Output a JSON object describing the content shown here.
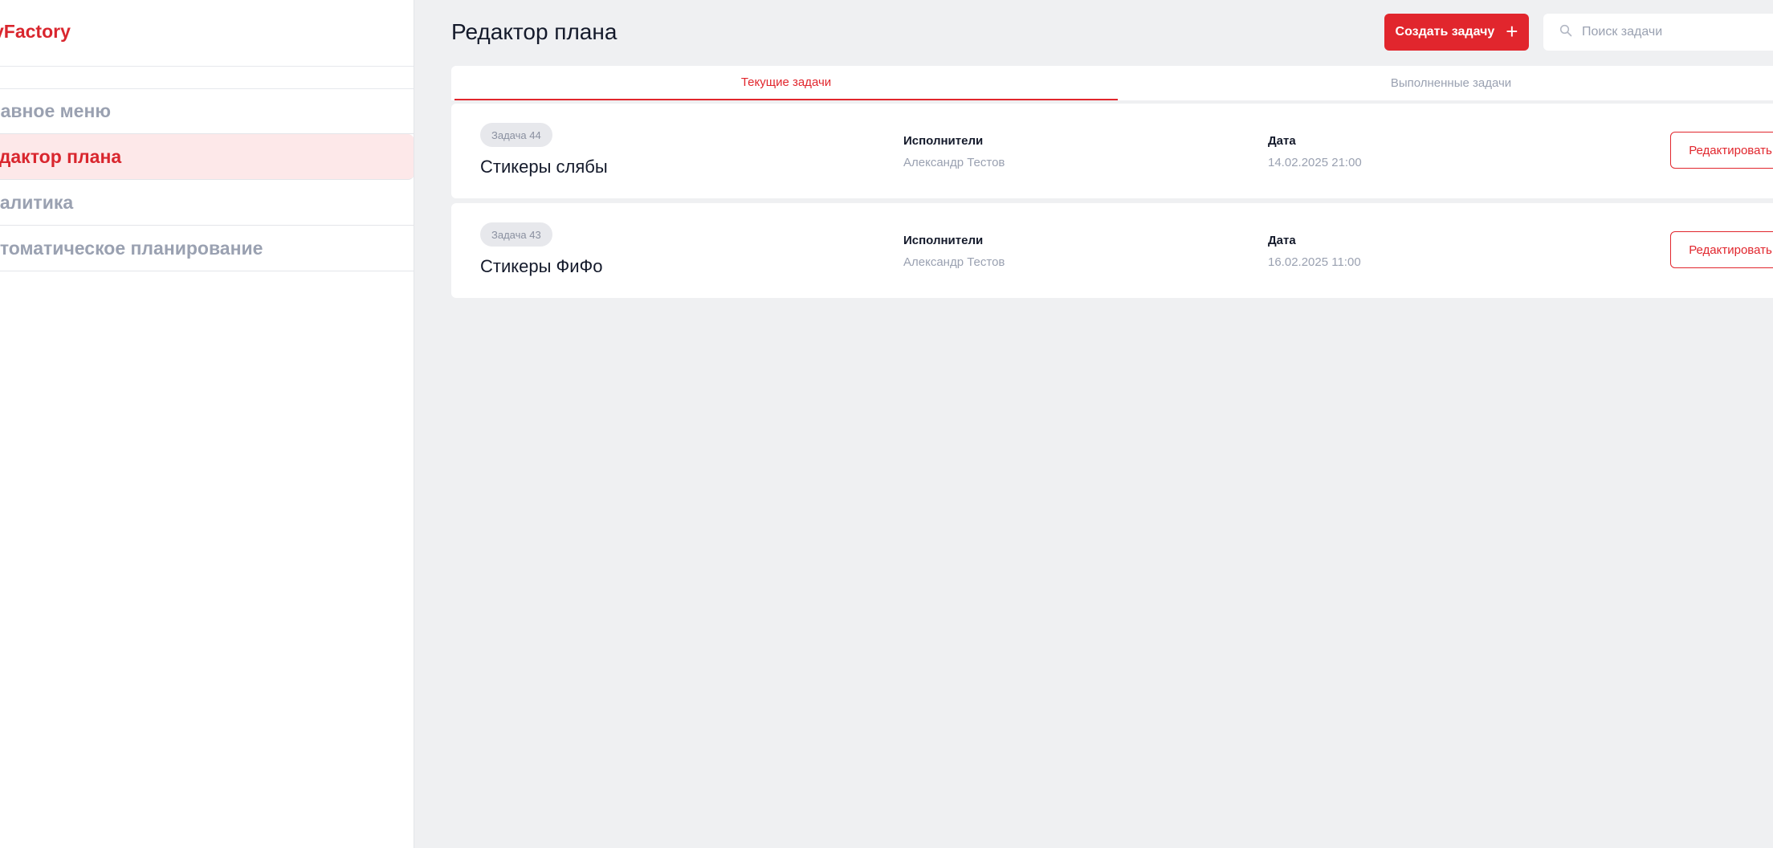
{
  "sidebar": {
    "logo_prefix": "y",
    "logo_main": "Factory",
    "items": [
      {
        "label": "лавное меню"
      },
      {
        "label": "едактор плана"
      },
      {
        "label": "налитика"
      },
      {
        "label": "втоматическое планирование"
      }
    ]
  },
  "header": {
    "title": "Редактор плана",
    "create_button": "Создать задачу",
    "create_icon": "+",
    "search_placeholder": "Поиск задачи"
  },
  "tabs": [
    {
      "label": "Текущие задачи",
      "active": true
    },
    {
      "label": "Выполненные задачи",
      "active": false
    }
  ],
  "columns": {
    "executors": "Исполнители",
    "date": "Дата"
  },
  "edit_label": "Редактировать",
  "tasks": [
    {
      "badge": "Задача 44",
      "name": "Стикеры слябы",
      "executor": "Александр Тестов",
      "date": "14.02.2025 21:00"
    },
    {
      "badge": "Задача 43",
      "name": "Стикеры ФиФо",
      "executor": "Александр Тестов",
      "date": "16.02.2025 11:00"
    }
  ],
  "colors": {
    "accent": "#e1262d",
    "muted": "#9aa1b1",
    "background": "#eff0f2"
  }
}
